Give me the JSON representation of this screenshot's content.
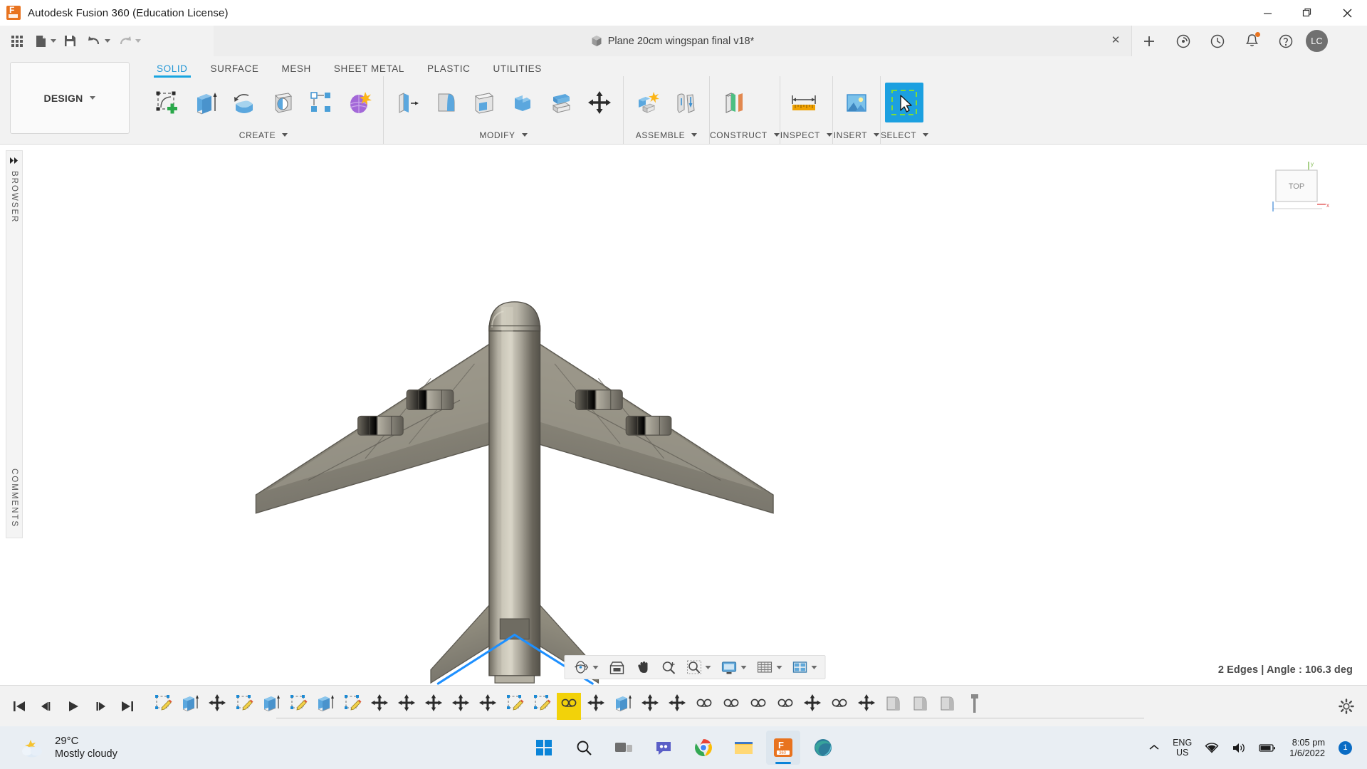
{
  "window": {
    "title": "Autodesk Fusion 360 (Education License)",
    "app_icon": "fusion360-logo-icon",
    "minimize_label": "─",
    "maximize_label": "❐",
    "close_label": "✕"
  },
  "quick_access": {
    "items": [
      {
        "name": "app-grid-button",
        "icon": "grid-apps-icon",
        "label": ""
      },
      {
        "name": "new-file-button",
        "icon": "file-new-icon",
        "label": "",
        "caret": true
      },
      {
        "name": "save-button",
        "icon": "save-floppy-icon",
        "label": ""
      },
      {
        "name": "undo-button",
        "icon": "undo-arrow-icon",
        "label": "",
        "caret": true
      },
      {
        "name": "redo-button",
        "icon": "redo-arrow-icon",
        "label": "",
        "caret": true
      }
    ]
  },
  "document_tab": {
    "icon": "cube-icon",
    "label": "Plane 20cm wingspan final v18*",
    "close_label": "✕"
  },
  "tab_controls": [
    {
      "name": "new-design-tab-button",
      "icon": "plus-icon",
      "label": "+"
    },
    {
      "name": "job-status-button",
      "icon": "job-status-icon",
      "label": ""
    },
    {
      "name": "recent-activity-button",
      "icon": "clock-icon",
      "label": ""
    },
    {
      "name": "notifications-button",
      "icon": "bell-icon",
      "label": ""
    },
    {
      "name": "help-button",
      "icon": "question-mark-icon",
      "label": ""
    }
  ],
  "account": {
    "initials": "LC"
  },
  "workspace": {
    "label": "DESIGN",
    "caret": true
  },
  "ribbon_tabs": [
    {
      "label": "SOLID",
      "active": true
    },
    {
      "label": "SURFACE",
      "active": false
    },
    {
      "label": "MESH",
      "active": false
    },
    {
      "label": "SHEET METAL",
      "active": false
    },
    {
      "label": "PLASTIC",
      "active": false
    },
    {
      "label": "UTILITIES",
      "active": false
    }
  ],
  "ribbon_panels": [
    {
      "title": "CREATE",
      "caret": true,
      "tools": [
        {
          "name": "create-sketch-tool",
          "icon": "sketch-plus-icon"
        },
        {
          "name": "extrude-tool",
          "icon": "extrude-icon"
        },
        {
          "name": "revolve-tool",
          "icon": "revolve-icon"
        },
        {
          "name": "sweep-tool",
          "icon": "sweep-icon"
        },
        {
          "name": "pattern-tool",
          "icon": "rectangular-pattern-icon"
        },
        {
          "name": "form-tool",
          "icon": "create-form-icon"
        }
      ]
    },
    {
      "title": "MODIFY",
      "caret": true,
      "tools": [
        {
          "name": "press-pull-tool",
          "icon": "press-pull-icon"
        },
        {
          "name": "fillet-tool",
          "icon": "fillet-icon"
        },
        {
          "name": "shell-tool",
          "icon": "shell-icon"
        },
        {
          "name": "combine-tool",
          "icon": "combine-icon"
        },
        {
          "name": "offset-face-tool",
          "icon": "offset-face-icon"
        },
        {
          "name": "move-copy-tool",
          "icon": "move-copy-icon"
        }
      ]
    },
    {
      "title": "ASSEMBLE",
      "caret": true,
      "tools": [
        {
          "name": "new-component-tool",
          "icon": "new-component-icon"
        },
        {
          "name": "joint-tool",
          "icon": "joint-icon"
        }
      ]
    },
    {
      "title": "CONSTRUCT",
      "caret": true,
      "tools": [
        {
          "name": "offset-plane-tool",
          "icon": "construction-plane-icon"
        }
      ]
    },
    {
      "title": "INSPECT",
      "caret": true,
      "tools": [
        {
          "name": "measure-tool",
          "icon": "measure-ruler-icon"
        }
      ]
    },
    {
      "title": "INSERT",
      "caret": true,
      "tools": [
        {
          "name": "insert-canvas-tool",
          "icon": "insert-image-icon"
        }
      ]
    },
    {
      "title": "SELECT",
      "caret": true,
      "tools": [
        {
          "name": "select-tool",
          "icon": "cursor-select-icon",
          "selected": true
        }
      ]
    }
  ],
  "left_rail": {
    "expand_icon": "double-chevron-right-icon",
    "browser_label": "BROWSER",
    "comments_label": "COMMENTS"
  },
  "viewcube": {
    "face_label": "TOP",
    "axis_x_label": "x",
    "axis_y_label": "y"
  },
  "viewport": {
    "model_name": "airplane-top-view-model",
    "status_text": "2 Edges | Angle : 106.3 deg",
    "selection_color": "#1e90ff",
    "model_color": "#8b8878"
  },
  "navigation_bar": {
    "items": [
      {
        "name": "orbit-tool",
        "icon": "orbit-icon",
        "caret": true
      },
      {
        "name": "look-at-tool",
        "icon": "look-at-icon",
        "caret": false
      },
      {
        "name": "pan-tool",
        "icon": "hand-pan-icon",
        "caret": false
      },
      {
        "name": "zoom-tool",
        "icon": "magnifier-plus-icon",
        "caret": false
      },
      {
        "name": "fit-tool",
        "icon": "zoom-fit-icon",
        "caret": true
      },
      {
        "name": "display-settings",
        "icon": "monitor-display-icon",
        "caret": true
      },
      {
        "name": "grid-snaps",
        "icon": "grid-icon",
        "caret": true
      },
      {
        "name": "viewport-layout",
        "icon": "viewport-layout-icon",
        "caret": true
      }
    ]
  },
  "timeline": {
    "playback": [
      {
        "name": "timeline-go-to-beginning",
        "icon": "skip-back-icon"
      },
      {
        "name": "timeline-step-back",
        "icon": "step-back-icon"
      },
      {
        "name": "timeline-play",
        "icon": "play-icon"
      },
      {
        "name": "timeline-step-forward",
        "icon": "step-forward-icon"
      },
      {
        "name": "timeline-go-to-end",
        "icon": "skip-forward-icon"
      }
    ],
    "features": [
      {
        "type": "sketch",
        "highlighted": false
      },
      {
        "type": "extrude",
        "highlighted": false
      },
      {
        "type": "move",
        "highlighted": false
      },
      {
        "type": "sketch",
        "highlighted": false
      },
      {
        "type": "extrude",
        "highlighted": false
      },
      {
        "type": "sketch",
        "highlighted": false
      },
      {
        "type": "extrude",
        "highlighted": false
      },
      {
        "type": "sketch",
        "highlighted": false
      },
      {
        "type": "move",
        "highlighted": false
      },
      {
        "type": "move",
        "highlighted": false
      },
      {
        "type": "move",
        "highlighted": false
      },
      {
        "type": "move",
        "highlighted": false
      },
      {
        "type": "move",
        "highlighted": false
      },
      {
        "type": "sketch",
        "highlighted": false
      },
      {
        "type": "sketch",
        "highlighted": false
      },
      {
        "type": "joint",
        "highlighted": true
      },
      {
        "type": "move",
        "highlighted": false
      },
      {
        "type": "extrude",
        "highlighted": false
      },
      {
        "type": "move",
        "highlighted": false
      },
      {
        "type": "move",
        "highlighted": false
      },
      {
        "type": "joint",
        "highlighted": false
      },
      {
        "type": "joint",
        "highlighted": false
      },
      {
        "type": "joint",
        "highlighted": false
      },
      {
        "type": "joint",
        "highlighted": false
      },
      {
        "type": "move",
        "highlighted": false
      },
      {
        "type": "joint",
        "highlighted": false
      },
      {
        "type": "move",
        "highlighted": false
      },
      {
        "type": "fillet",
        "highlighted": false
      },
      {
        "type": "fillet",
        "highlighted": false
      },
      {
        "type": "fillet",
        "highlighted": false
      },
      {
        "type": "marker",
        "highlighted": false
      }
    ],
    "settings_icon": "gear-icon"
  },
  "taskbar": {
    "weather": {
      "icon": "partly-cloudy-icon",
      "temperature": "29°C",
      "condition": "Mostly cloudy"
    },
    "apps": [
      {
        "name": "start-button",
        "icon": "windows-logo-icon"
      },
      {
        "name": "search-button",
        "icon": "search-icon"
      },
      {
        "name": "task-view-button",
        "icon": "task-view-icon"
      },
      {
        "name": "chat-button",
        "icon": "chat-teams-icon"
      },
      {
        "name": "chrome-button",
        "icon": "chrome-browser-icon"
      },
      {
        "name": "file-explorer-button",
        "icon": "folder-explorer-icon"
      },
      {
        "name": "fusion360-button",
        "icon": "fusion360-icon",
        "active": true
      },
      {
        "name": "edge-button",
        "icon": "edge-browser-icon"
      }
    ],
    "tray": {
      "overflow_icon": "chevron-up-icon",
      "language_line1": "ENG",
      "language_line2": "US",
      "network_icon": "wifi-icon",
      "volume_icon": "speaker-icon",
      "battery_icon": "battery-icon",
      "time": "8:05 pm",
      "date": "1/6/2022",
      "notification_count": "1"
    }
  }
}
